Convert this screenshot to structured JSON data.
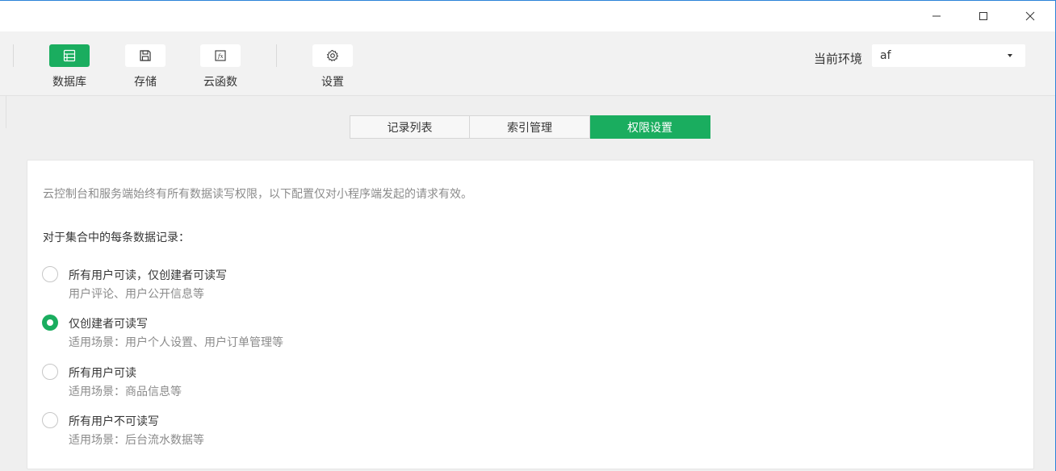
{
  "window_controls": {
    "minimize": "minimize-icon",
    "maximize": "maximize-icon",
    "close": "close-icon"
  },
  "toolbar": {
    "tools": [
      {
        "label": "数据库",
        "icon": "database-icon",
        "active": true
      },
      {
        "label": "存储",
        "icon": "save-icon",
        "active": false
      },
      {
        "label": "云函数",
        "icon": "function-icon",
        "active": false
      },
      {
        "label": "设置",
        "icon": "gear-icon",
        "active": false
      }
    ],
    "env_label": "当前环境",
    "env_value": "af"
  },
  "tabs": [
    {
      "label": "记录列表",
      "active": false
    },
    {
      "label": "索引管理",
      "active": false
    },
    {
      "label": "权限设置",
      "active": true
    }
  ],
  "content": {
    "notice": "云控制台和服务端始终有所有数据读写权限，以下配置仅对小程序端发起的请求有效。",
    "subtitle": "对于集合中的每条数据记录：",
    "options": [
      {
        "title": "所有用户可读，仅创建者可读写",
        "desc": "用户评论、用户公开信息等",
        "checked": false
      },
      {
        "title": "仅创建者可读写",
        "desc": "适用场景：用户个人设置、用户订单管理等",
        "checked": true
      },
      {
        "title": "所有用户可读",
        "desc": "适用场景：商品信息等",
        "checked": false
      },
      {
        "title": "所有用户不可读写",
        "desc": "适用场景：后台流水数据等",
        "checked": false
      }
    ]
  },
  "colors": {
    "accent": "#1aad5f",
    "muted_text": "#8b8b8b",
    "text": "#353535"
  }
}
